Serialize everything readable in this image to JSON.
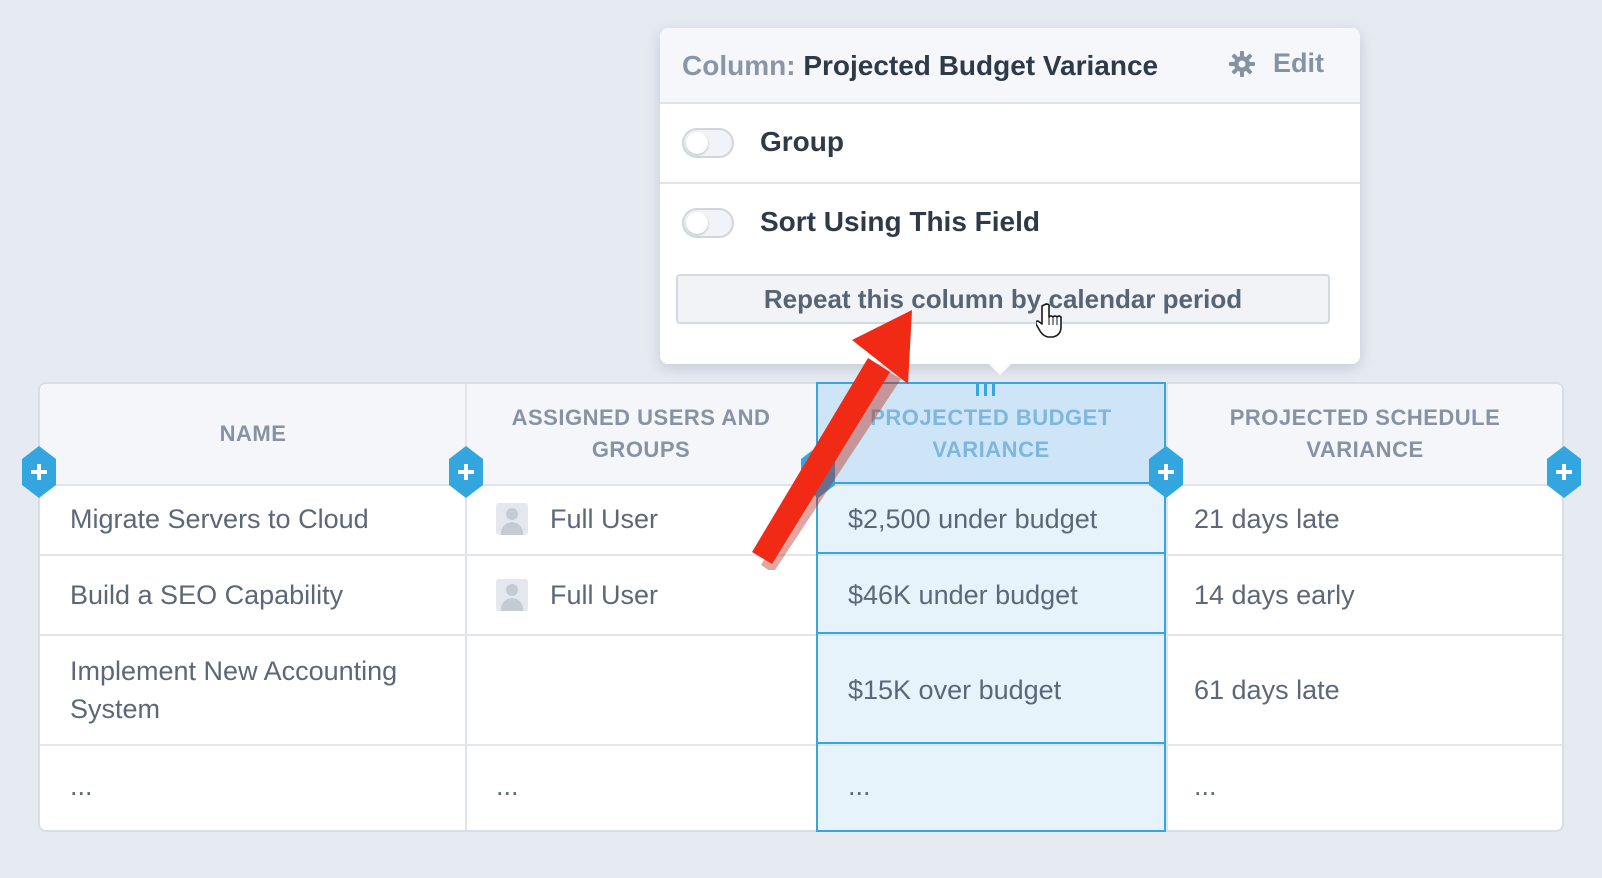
{
  "popover": {
    "title_prefix": "Column:",
    "title_name": "Projected Budget Variance",
    "edit_label": "Edit",
    "options": [
      {
        "label": "Group",
        "enabled": false
      },
      {
        "label": "Sort Using This Field",
        "enabled": false
      }
    ],
    "repeat_button": "Repeat this column by calendar period"
  },
  "table": {
    "columns": [
      "NAME",
      "ASSIGNED USERS AND GROUPS",
      "PROJECTED BUDGET VARIANCE",
      "PROJECTED SCHEDULE VARIANCE"
    ],
    "rows": [
      {
        "name": "Migrate Servers to Cloud",
        "user": "Full User",
        "budget": "$2,500 under budget",
        "schedule": "21 days late"
      },
      {
        "name": "Build a SEO Capability",
        "user": "Full User",
        "budget": "$46K under budget",
        "schedule": "14 days early"
      },
      {
        "name": "Implement New Accounting System",
        "user": "",
        "budget": "$15K over budget",
        "schedule": "61 days late"
      },
      {
        "name": "...",
        "user": "...",
        "budget": "...",
        "schedule": "..."
      }
    ]
  },
  "colors": {
    "accent": "#3aa4e0",
    "arrow": "#f02a14"
  }
}
